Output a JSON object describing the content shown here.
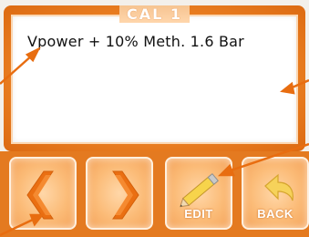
{
  "screen": {
    "title": "CAL 1",
    "text": "Vpower + 10% Meth. 1.6 Bar"
  },
  "buttons": {
    "prev": {
      "icon": "chevron-left-icon"
    },
    "next": {
      "icon": "chevron-right-icon"
    },
    "edit": {
      "label": "EDIT",
      "icon": "pencil-icon"
    },
    "back": {
      "label": "BACK",
      "icon": "back-arrow-icon"
    }
  },
  "colors": {
    "frame": "#ea7f22",
    "button": "#fbbb77",
    "accent": "#e86d10"
  }
}
